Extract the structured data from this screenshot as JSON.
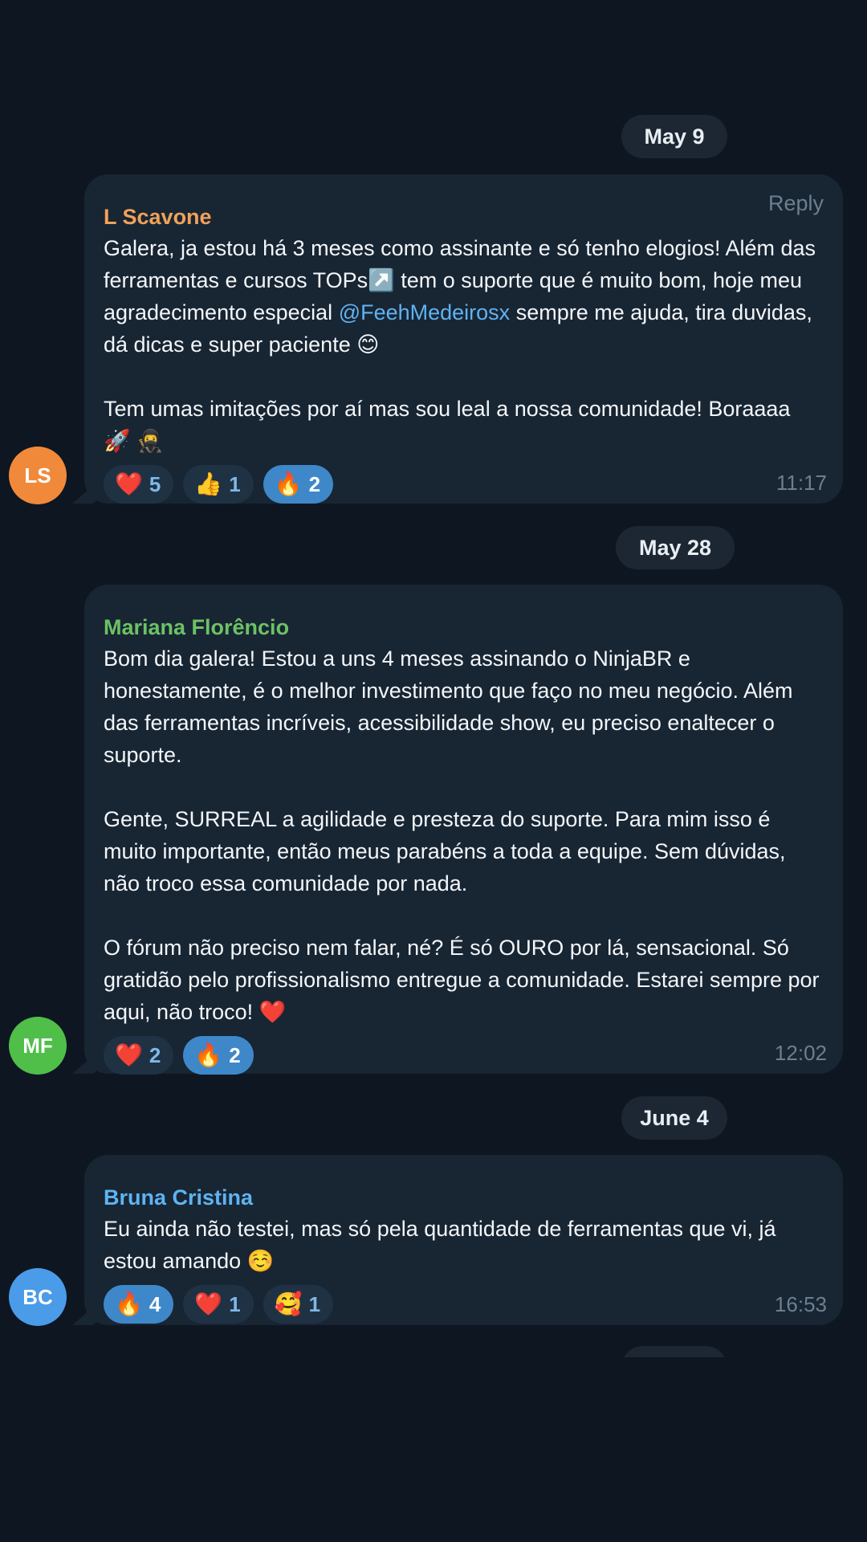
{
  "colors": {
    "background": "#0e1621",
    "bubble": "#182533",
    "mention": "#5fb3f2",
    "sender_orange": "#f0a259",
    "sender_green": "#6cc264",
    "sender_blue": "#5fb3f2"
  },
  "messages": [
    {
      "date": "May 9",
      "sender": "L Scavone",
      "sender_color": "#f0a259",
      "reply_label": "Reply",
      "text_before": "Galera, ja estou há 3 meses como assinante e só tenho elogios! Além das ferramentas e cursos TOPs↗️ tem o suporte que é muito bom, hoje meu agradecimento especial ",
      "mention": "@FeehMedeirosx",
      "text_after": " sempre me ajuda, tira duvidas, dá dicas e super paciente 😊\n\nTem umas imitações por aí mas sou leal a nossa comunidade! Boraaaa 🚀 🥷",
      "reactions": [
        {
          "emoji": "❤️",
          "count": "5",
          "active": false
        },
        {
          "emoji": "👍",
          "count": "1",
          "active": false
        },
        {
          "emoji": "🔥",
          "count": "2",
          "active": true
        }
      ],
      "time": "11:17",
      "avatar_initials": "LS",
      "avatar_color": "#f08a3a"
    },
    {
      "date": "May 28",
      "sender": "Mariana Florêncio",
      "sender_color": "#6cc264",
      "text": "Bom dia galera! Estou a uns 4 meses assinando o NinjaBR e honestamente, é o melhor investimento que faço no meu negócio. Além das ferramentas incríveis, acessibilidade show, eu preciso enaltecer o suporte.\n\nGente, SURREAL a agilidade e presteza do suporte. Para mim isso é muito importante, então meus parabéns a toda a equipe. Sem dúvidas, não troco essa comunidade por nada.\n\nO fórum não preciso nem falar, né? É só OURO por lá, sensacional. Só gratidão pelo profissionalismo entregue a comunidade. Estarei sempre por aqui, não troco! ❤️",
      "reactions": [
        {
          "emoji": "❤️",
          "count": "2",
          "active": false
        },
        {
          "emoji": "🔥",
          "count": "2",
          "active": true
        }
      ],
      "time": "12:02",
      "avatar_initials": "MF",
      "avatar_color": "#4fbf4a"
    },
    {
      "date": "June 4",
      "sender": "Bruna Cristina",
      "sender_color": "#5fb3f2",
      "text": "Eu ainda não testei, mas só pela quantidade de ferramentas que vi, já estou amando ☺️",
      "reactions": [
        {
          "emoji": "🔥",
          "count": "4",
          "active": true
        },
        {
          "emoji": "❤️",
          "count": "1",
          "active": false
        },
        {
          "emoji": "🥰",
          "count": "1",
          "active": false
        }
      ],
      "time": "16:53",
      "avatar_initials": "BC",
      "avatar_color": "#4a9be8"
    }
  ]
}
